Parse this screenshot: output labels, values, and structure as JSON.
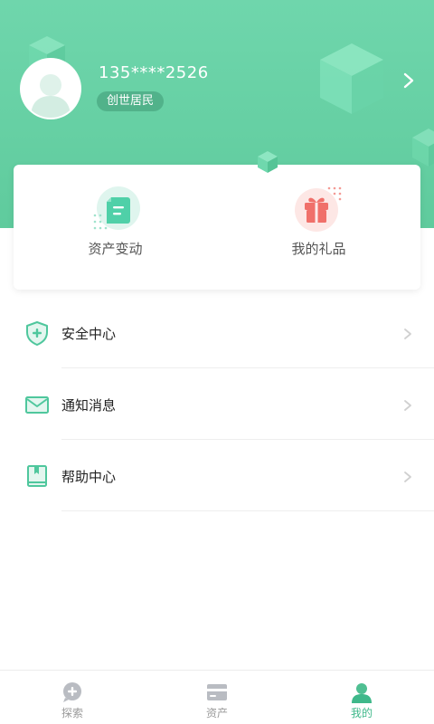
{
  "profile": {
    "phone": "135****2526",
    "level_badge": "创世居民"
  },
  "quick_actions": [
    {
      "label": "资产变动",
      "icon": "document-icon"
    },
    {
      "label": "我的礼品",
      "icon": "gift-icon"
    }
  ],
  "menu": [
    {
      "label": "安全中心",
      "icon": "shield-icon"
    },
    {
      "label": "通知消息",
      "icon": "mail-icon"
    },
    {
      "label": "帮助中心",
      "icon": "book-icon"
    }
  ],
  "tabs": [
    {
      "label": "探索",
      "icon": "explore-icon",
      "active": false
    },
    {
      "label": "资产",
      "icon": "card-icon",
      "active": false
    },
    {
      "label": "我的",
      "icon": "user-icon",
      "active": true
    }
  ],
  "colors": {
    "brand_green": "#5fcb9d",
    "active_tab": "#3fb88a",
    "gift_red": "#f0706a"
  }
}
